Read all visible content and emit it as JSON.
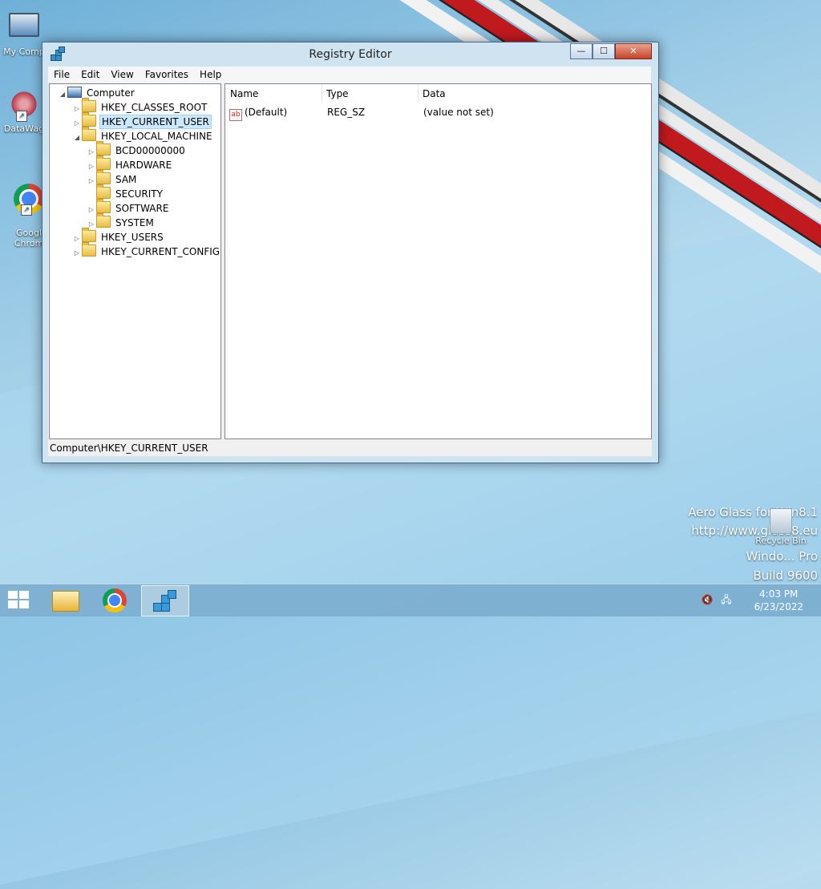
{
  "window": {
    "title": "Registry Editor",
    "buttons": {
      "minimize": "—",
      "maximize": "☐",
      "close": "✕"
    }
  },
  "menu": [
    "File",
    "Edit",
    "View",
    "Favorites",
    "Help"
  ],
  "tree": {
    "root": "Computer",
    "nodes": [
      {
        "label": "HKEY_CLASSES_ROOT",
        "level": 1,
        "expander": "▷",
        "selected": false
      },
      {
        "label": "HKEY_CURRENT_USER",
        "level": 1,
        "expander": "▷",
        "selected": true
      },
      {
        "label": "HKEY_LOCAL_MACHINE",
        "level": 1,
        "expander": "◢",
        "selected": false
      },
      {
        "label": "BCD00000000",
        "level": 2,
        "expander": "▷",
        "selected": false
      },
      {
        "label": "HARDWARE",
        "level": 2,
        "expander": "▷",
        "selected": false
      },
      {
        "label": "SAM",
        "level": 2,
        "expander": "▷",
        "selected": false
      },
      {
        "label": "SECURITY",
        "level": 2,
        "expander": "",
        "selected": false
      },
      {
        "label": "SOFTWARE",
        "level": 2,
        "expander": "▷",
        "selected": false
      },
      {
        "label": "SYSTEM",
        "level": 2,
        "expander": "▷",
        "selected": false
      },
      {
        "label": "HKEY_USERS",
        "level": 1,
        "expander": "▷",
        "selected": false
      },
      {
        "label": "HKEY_CURRENT_CONFIG",
        "level": 1,
        "expander": "▷",
        "selected": false
      }
    ]
  },
  "list": {
    "columns": [
      "Name",
      "Type",
      "Data"
    ],
    "rows": [
      {
        "icon": "ab",
        "name": "(Default)",
        "type": "REG_SZ",
        "data": "(value not set)"
      }
    ]
  },
  "status": "Computer\\HKEY_CURRENT_USER",
  "desktop": {
    "icons": [
      {
        "label": "My Comp",
        "icon": "computer-icon"
      },
      {
        "label": "DataWag",
        "icon": "datawag-icon"
      },
      {
        "label": "Googl\nChrom",
        "icon": "chrome-icon"
      }
    ],
    "recycle_bin": "Recycle Bin",
    "watermark": [
      "Aero Glass for Win8.1",
      "http://www.glass8.eu",
      "Windo... Pro",
      "Build 9600"
    ]
  },
  "taskbar": {
    "time": "4:03 PM",
    "date": "6/23/2022"
  }
}
